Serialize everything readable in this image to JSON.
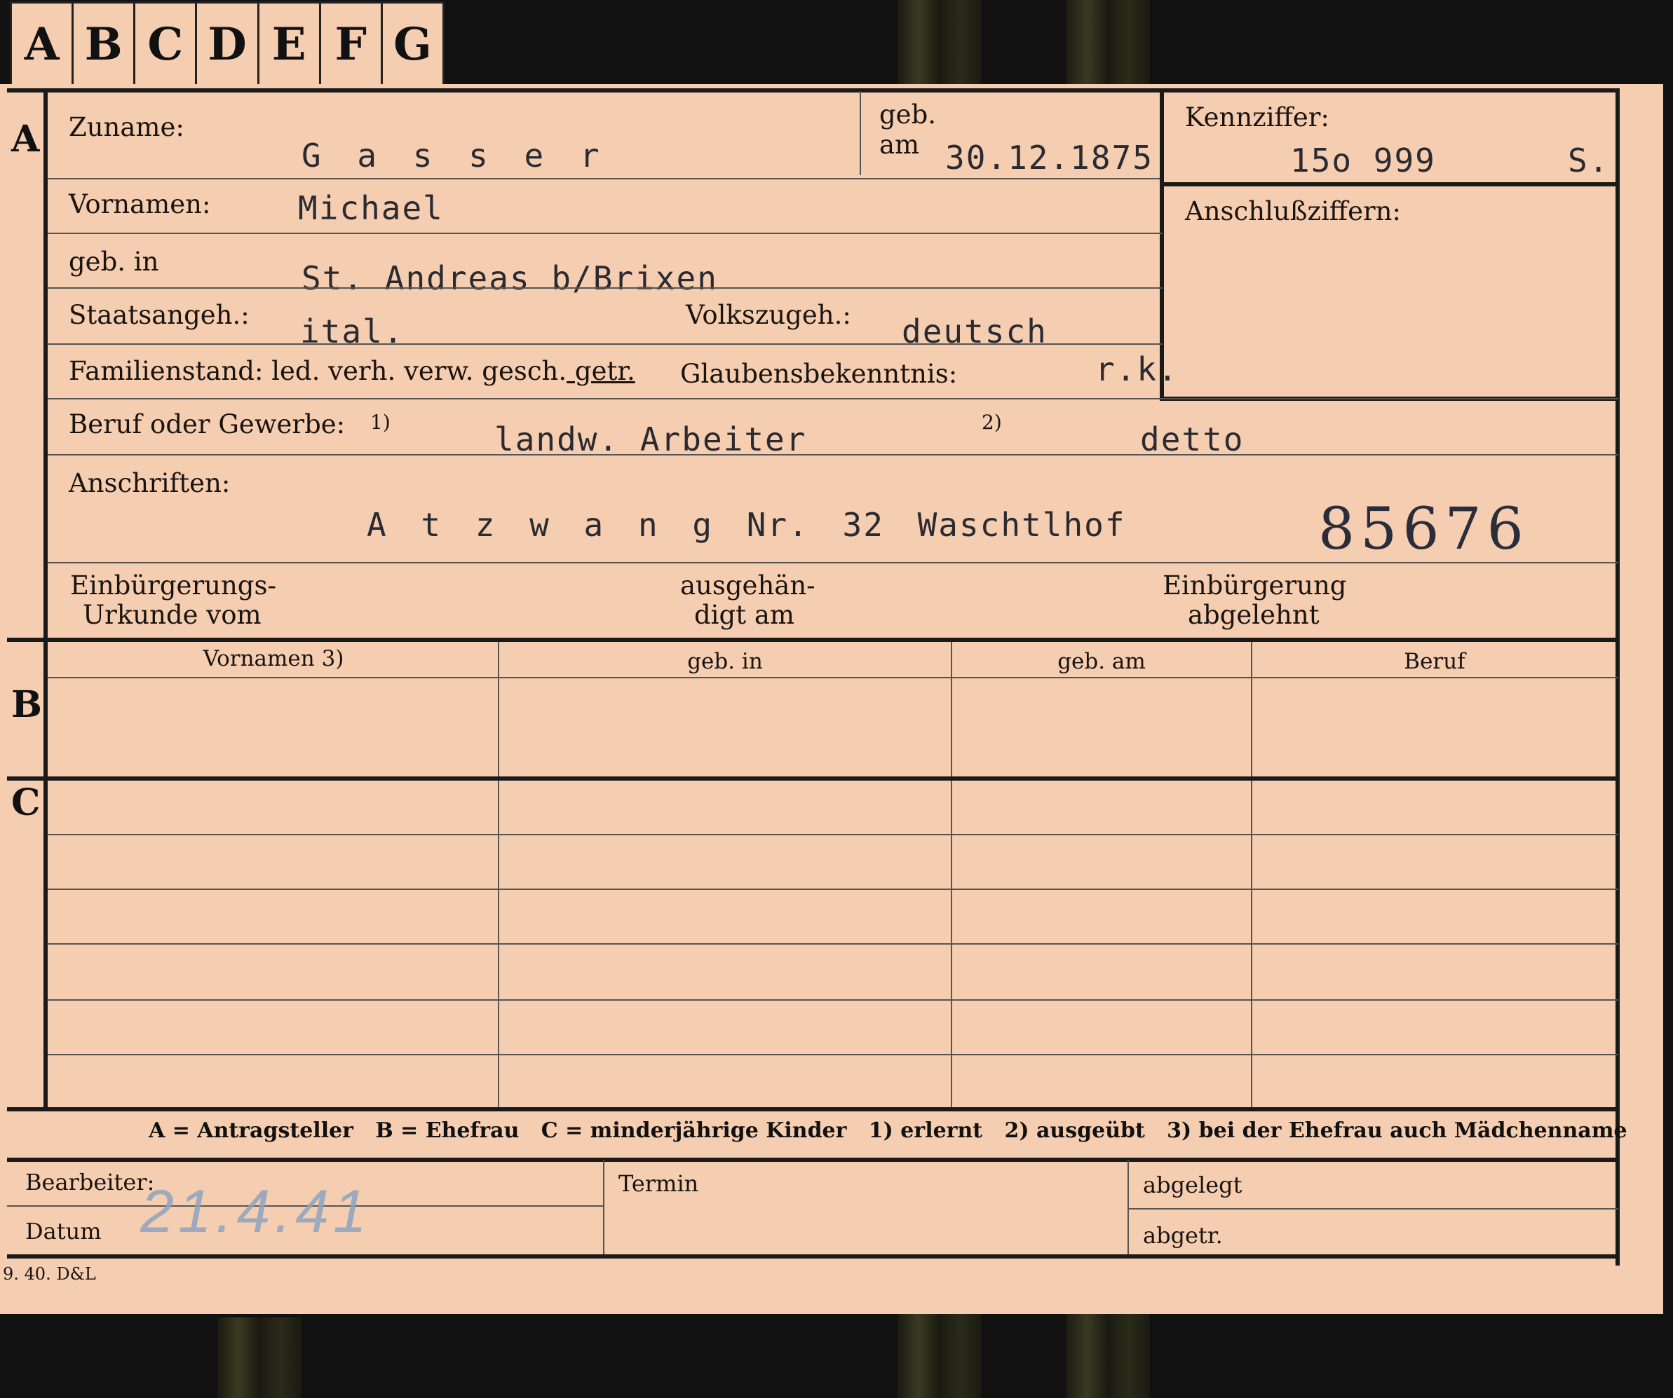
{
  "tabs": [
    "A",
    "B",
    "C",
    "D",
    "E",
    "F",
    "G"
  ],
  "sections": {
    "a": "A",
    "b": "B",
    "c": "C"
  },
  "fields": {
    "zuname_label": "Zuname:",
    "zuname_value": "G a s s e r",
    "geb_label": "geb.",
    "am_label": "am",
    "geb_am_value": "30.12.1875",
    "kennziffer_label": "Kennziffer:",
    "kennziffer_value": "15o 999",
    "kennziffer_suffix": "S.",
    "anschluss_label": "Anschlußziffern:",
    "vornamen_label": "Vornamen:",
    "vornamen_value": "Michael",
    "gebin_label": "geb. in",
    "gebin_value": "St. Andreas b/Brixen",
    "staats_label": "Staatsangeh.:",
    "staats_value": "ital.",
    "volks_label": "Volkszugeh.:",
    "volks_value": "deutsch",
    "familien_label": "Familienstand: led. verh. verw. gesch.",
    "familien_marked": " getr.",
    "glauben_label": "Glaubensbekenntnis:",
    "glauben_value": "r.k.",
    "beruf_label": "Beruf oder Gewerbe:",
    "beruf_note1": "1)",
    "beruf_value1": "landw. Arbeiter",
    "beruf_note2": "2)",
    "beruf_value2": "detto",
    "anschriften_label": "Anschriften:",
    "anschriften_value": "A t z w a n g  Nr. 32  Waschtlhof",
    "card_number": "85676",
    "einb_urkunde_1": "Einbürgerungs-",
    "einb_urkunde_2": "Urkunde vom",
    "ausgehaend_1": "ausgehän-",
    "ausgehaend_2": "digt am",
    "einb_abgelehnt_1": "Einbürgerung",
    "einb_abgelehnt_2": "abgelehnt"
  },
  "table_headers": [
    "Vornamen 3)",
    "geb. in",
    "geb. am",
    "Beruf"
  ],
  "legend": "A = Antragsteller   B = Ehefrau   C = minderjährige Kinder   1) erlernt   2) ausgeübt   3) bei der Ehefrau auch Mädchenname",
  "footer": {
    "bearbeiter_label": "Bearbeiter:",
    "datum_label": "Datum",
    "datum_stamp": "21.4.41",
    "termin_label": "Termin",
    "abgelegt_label": "abgelegt",
    "abgetr_label": "abgetr."
  },
  "print_code": "9. 40. D&L"
}
